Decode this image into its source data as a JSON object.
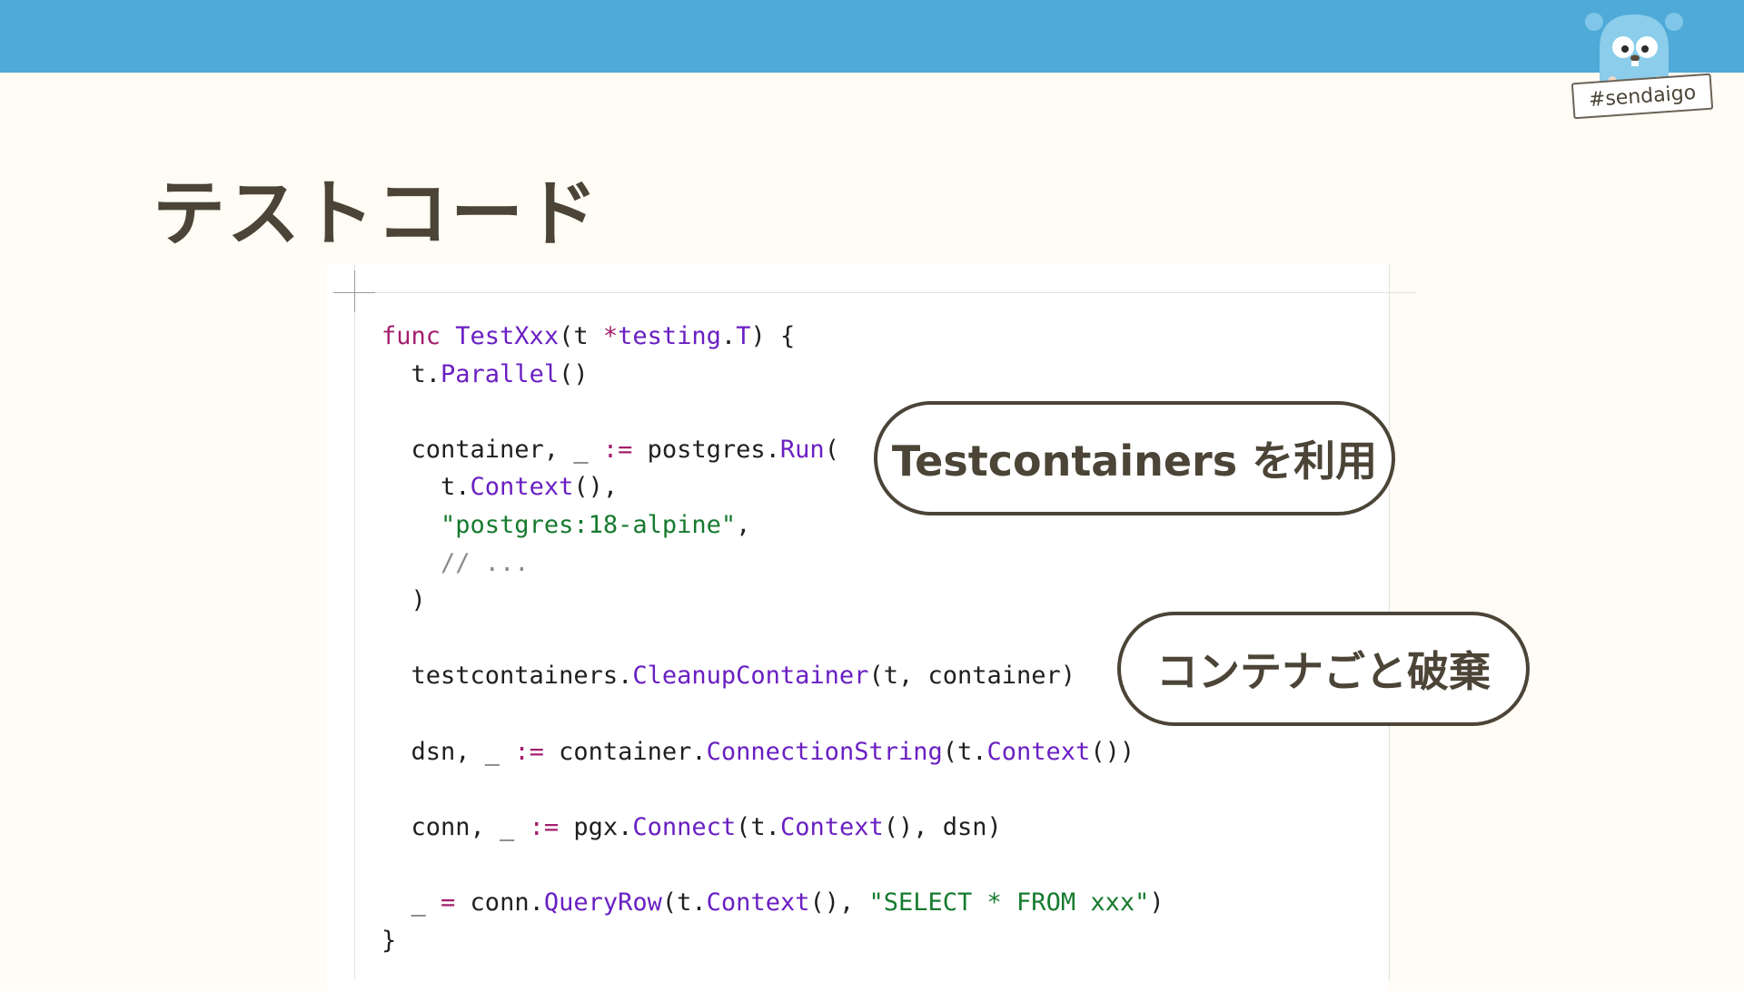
{
  "header": {
    "badge_label": "#sendaigo"
  },
  "slide": {
    "title": "テストコード"
  },
  "colors": {
    "header_bar": "#4faad7",
    "background": "#fefcf4",
    "text_dark": "#4b4437",
    "keyword": "#a31f6e",
    "function": "#6a1fc2",
    "string": "#167a2e",
    "comment": "#8a8a8a"
  },
  "code": {
    "lines": [
      [
        {
          "t": "kw",
          "v": "func "
        },
        {
          "t": "fn",
          "v": "TestXxx"
        },
        {
          "t": "plain",
          "v": "(t "
        },
        {
          "t": "kw",
          "v": "*"
        },
        {
          "t": "fn",
          "v": "testing"
        },
        {
          "t": "plain",
          "v": "."
        },
        {
          "t": "fn",
          "v": "T"
        },
        {
          "t": "plain",
          "v": ") {"
        }
      ],
      [
        {
          "t": "plain",
          "v": "  t."
        },
        {
          "t": "fn",
          "v": "Parallel"
        },
        {
          "t": "plain",
          "v": "()"
        }
      ],
      [],
      [
        {
          "t": "plain",
          "v": "  container, _ "
        },
        {
          "t": "kw",
          "v": ":="
        },
        {
          "t": "plain",
          "v": " postgres."
        },
        {
          "t": "fn",
          "v": "Run"
        },
        {
          "t": "plain",
          "v": "("
        }
      ],
      [
        {
          "t": "plain",
          "v": "    t."
        },
        {
          "t": "fn",
          "v": "Context"
        },
        {
          "t": "plain",
          "v": "(),"
        }
      ],
      [
        {
          "t": "plain",
          "v": "    "
        },
        {
          "t": "str",
          "v": "\"postgres:18-alpine\""
        },
        {
          "t": "plain",
          "v": ","
        }
      ],
      [
        {
          "t": "cm",
          "v": "    // ..."
        }
      ],
      [
        {
          "t": "plain",
          "v": "  )"
        }
      ],
      [],
      [
        {
          "t": "plain",
          "v": "  testcontainers."
        },
        {
          "t": "fn",
          "v": "CleanupContainer"
        },
        {
          "t": "plain",
          "v": "(t, container)"
        }
      ],
      [],
      [
        {
          "t": "plain",
          "v": "  dsn, _ "
        },
        {
          "t": "kw",
          "v": ":="
        },
        {
          "t": "plain",
          "v": " container."
        },
        {
          "t": "fn",
          "v": "ConnectionString"
        },
        {
          "t": "plain",
          "v": "(t."
        },
        {
          "t": "fn",
          "v": "Context"
        },
        {
          "t": "plain",
          "v": "())"
        }
      ],
      [],
      [
        {
          "t": "plain",
          "v": "  conn, _ "
        },
        {
          "t": "kw",
          "v": ":="
        },
        {
          "t": "plain",
          "v": " pgx."
        },
        {
          "t": "fn",
          "v": "Connect"
        },
        {
          "t": "plain",
          "v": "(t."
        },
        {
          "t": "fn",
          "v": "Context"
        },
        {
          "t": "plain",
          "v": "(), dsn)"
        }
      ],
      [],
      [
        {
          "t": "plain",
          "v": "  _ "
        },
        {
          "t": "kw",
          "v": "="
        },
        {
          "t": "plain",
          "v": " conn."
        },
        {
          "t": "fn",
          "v": "QueryRow"
        },
        {
          "t": "plain",
          "v": "(t."
        },
        {
          "t": "fn",
          "v": "Context"
        },
        {
          "t": "plain",
          "v": "(), "
        },
        {
          "t": "str",
          "v": "\"SELECT * FROM xxx\""
        },
        {
          "t": "plain",
          "v": ")"
        }
      ],
      [
        {
          "t": "plain",
          "v": "}"
        }
      ]
    ]
  },
  "callouts": [
    {
      "text": "Testcontainers を利用"
    },
    {
      "text": "コンテナごと破棄"
    }
  ]
}
